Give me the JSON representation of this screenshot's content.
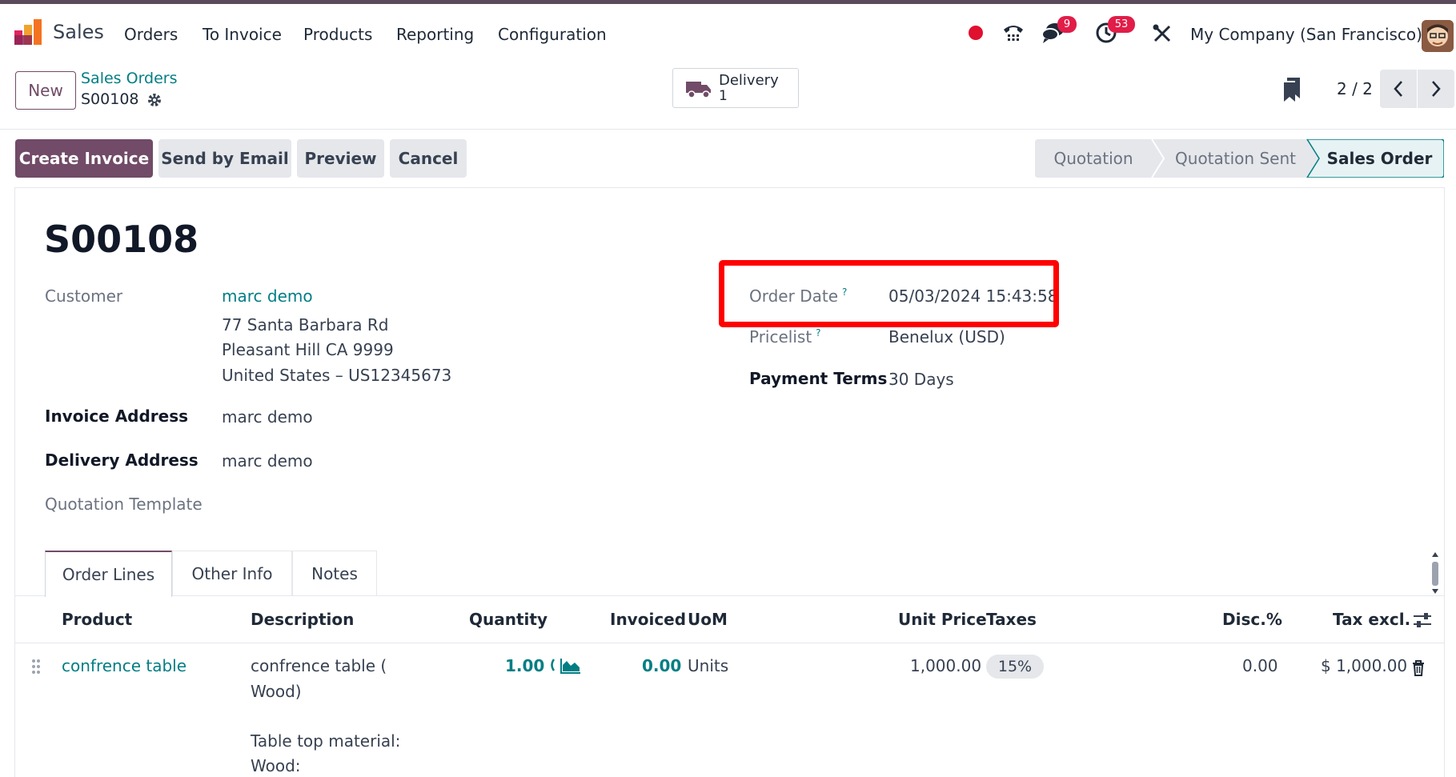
{
  "app": {
    "name": "Sales",
    "menu": [
      "Orders",
      "To Invoice",
      "Products",
      "Reporting",
      "Configuration"
    ],
    "company": "My Company (San Francisco)",
    "chat_count": "9",
    "activity_count": "53"
  },
  "control_panel": {
    "new_label": "New",
    "breadcrumb_parent": "Sales Orders",
    "breadcrumb_record": "S00108",
    "smart_button": {
      "label": "Delivery",
      "value": "1"
    },
    "pager": "2 / 2"
  },
  "actions": [
    "Create Invoice",
    "Send by Email",
    "Preview",
    "Cancel"
  ],
  "status": {
    "stages": [
      "Quotation",
      "Quotation Sent",
      "Sales Order"
    ],
    "current": "Sales Order"
  },
  "record": {
    "name": "S00108",
    "customer_label": "Customer",
    "customer": "marc demo",
    "address_line1": "77 Santa Barbara Rd",
    "address_line2": "Pleasant Hill CA 9999",
    "address_line3": "United States – US12345673",
    "invoice_address_label": "Invoice Address",
    "invoice_address": "marc demo",
    "delivery_address_label": "Delivery Address",
    "delivery_address": "marc demo",
    "quotation_template_label": "Quotation Template",
    "order_date_label": "Order Date",
    "order_date": "05/03/2024 15:43:58",
    "pricelist_label": "Pricelist",
    "pricelist": "Benelux (USD)",
    "payment_terms_label": "Payment Terms",
    "payment_terms": "30 Days",
    "help_mark": "?"
  },
  "tabs": [
    "Order Lines",
    "Other Info",
    "Notes"
  ],
  "order_lines": {
    "columns": [
      "Product",
      "Description",
      "Quantity",
      "Invoiced",
      "UoM",
      "Unit Price",
      "Taxes",
      "Disc.%",
      "Tax excl."
    ],
    "rows": [
      {
        "product": "confrence table",
        "description_line1": "confrence table (",
        "description_line2": "Wood)",
        "description_line3": "Table top material:",
        "description_line4": "Wood:",
        "quantity": "1.00",
        "invoiced": "0.00",
        "uom": "Units",
        "unit_price": "1,000.00",
        "taxes": "15%",
        "discount": "0.00",
        "subtotal": "$ 1,000.00"
      }
    ]
  },
  "colors": {
    "primary": "#714b67",
    "link": "#017e84",
    "highlight": "#ff0000",
    "badge": "#e11d48"
  }
}
